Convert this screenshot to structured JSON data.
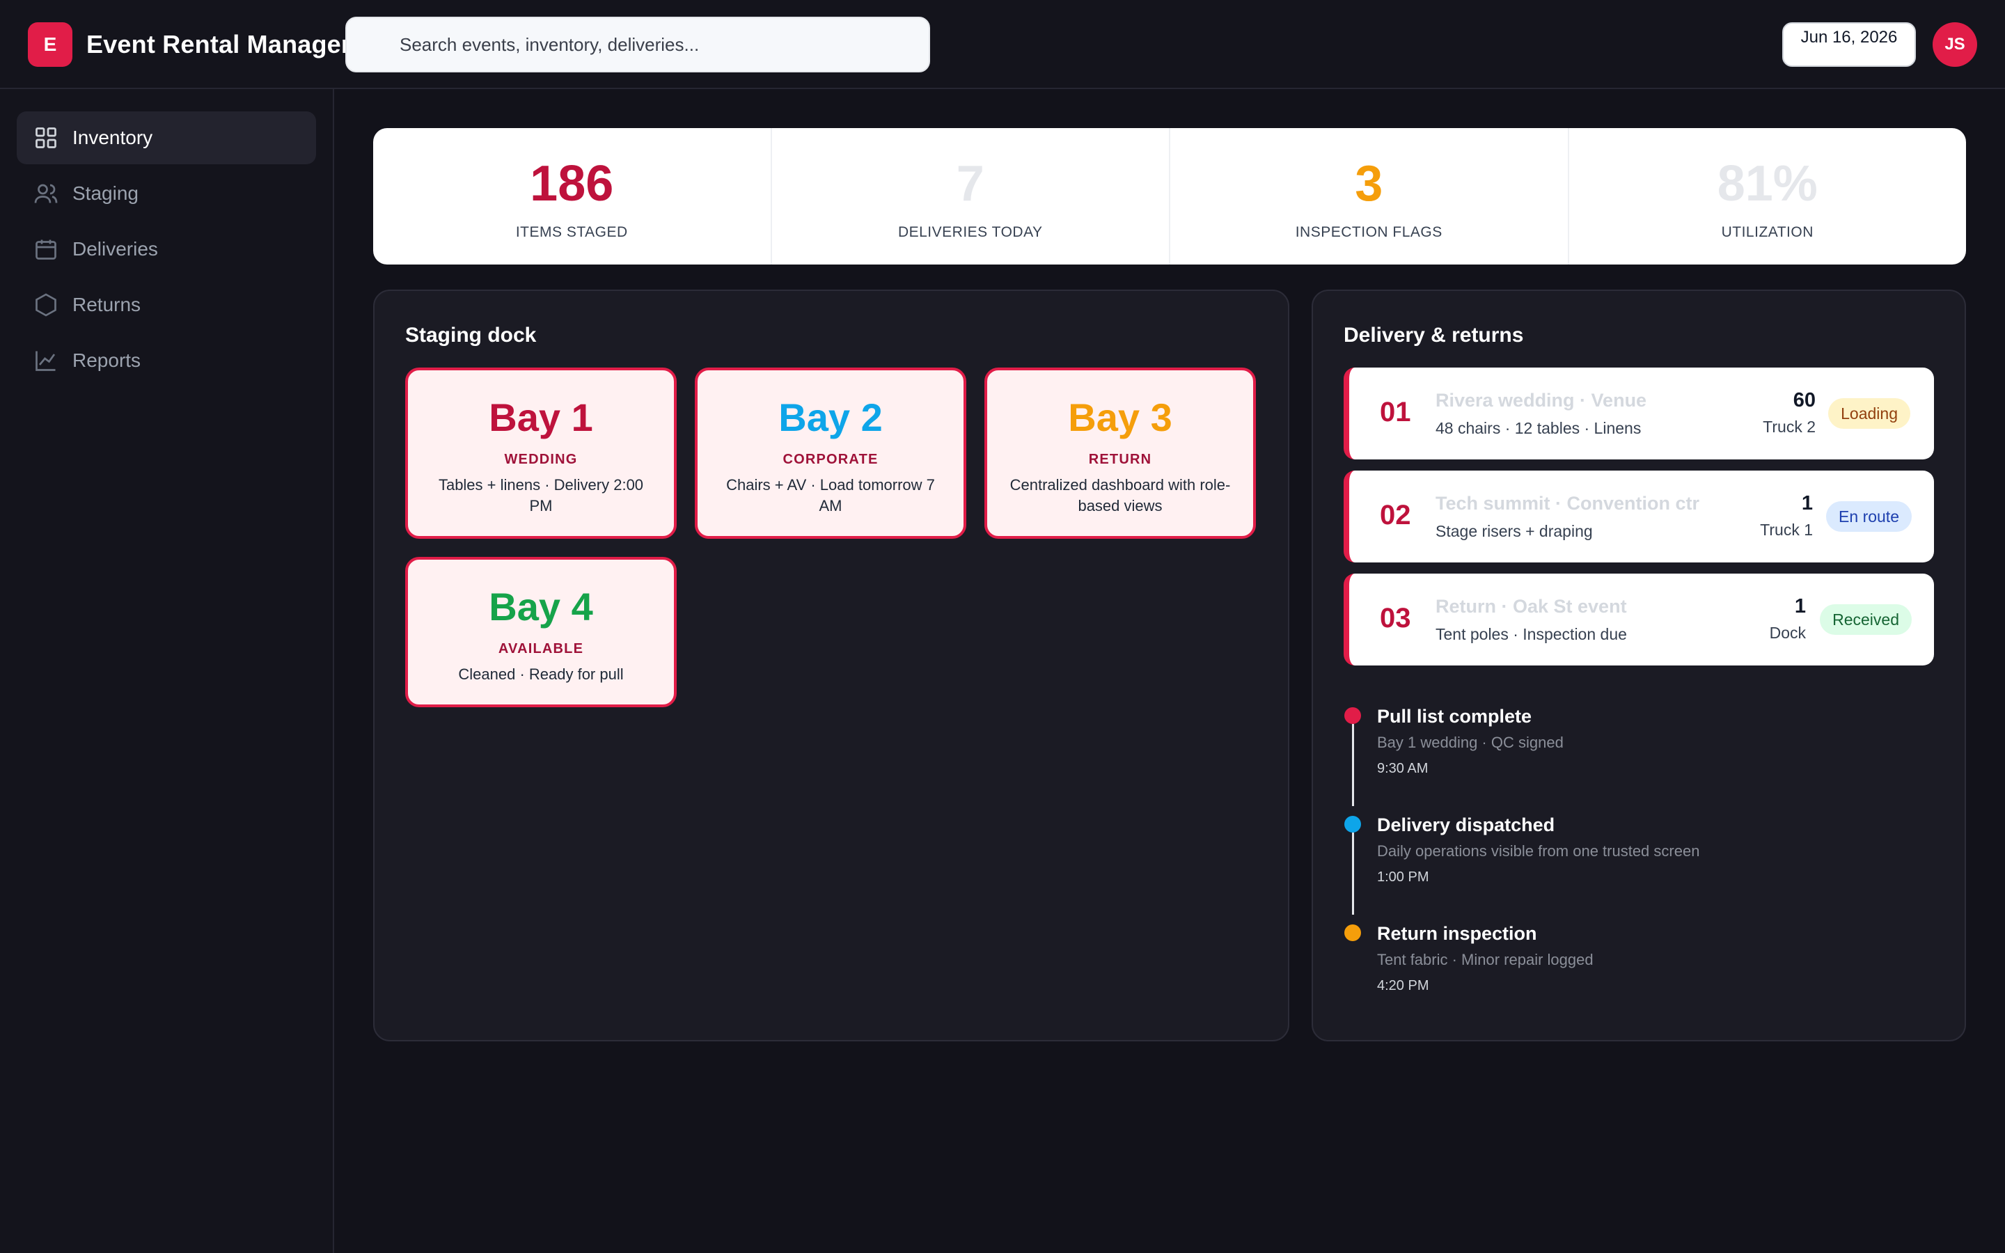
{
  "app": {
    "logo_letter": "E",
    "title": "Event Rental Manager"
  },
  "search": {
    "placeholder": "Search events, inventory, deliveries..."
  },
  "header": {
    "date": "Jun 16, 2026",
    "avatar_initials": "JS"
  },
  "sidebar": {
    "items": [
      {
        "label": "Inventory",
        "icon": "grid-icon",
        "active": true
      },
      {
        "label": "Staging",
        "icon": "users-icon",
        "active": false
      },
      {
        "label": "Deliveries",
        "icon": "calendar-icon",
        "active": false
      },
      {
        "label": "Returns",
        "icon": "hexagon-icon",
        "active": false
      },
      {
        "label": "Reports",
        "icon": "chart-line-icon",
        "active": false
      }
    ]
  },
  "stats": [
    {
      "value": "186",
      "label": "ITEMS STAGED",
      "color": "#be123c"
    },
    {
      "value": "7",
      "label": "DELIVERIES TODAY",
      "color": "#e5e7eb"
    },
    {
      "value": "3",
      "label": "INSPECTION FLAGS",
      "color": "#f59e0b"
    },
    {
      "value": "81%",
      "label": "UTILIZATION",
      "color": "#e5e7eb"
    }
  ],
  "staging": {
    "title": "Staging dock",
    "bays": [
      {
        "name": "Bay 1",
        "type": "WEDDING",
        "desc": "Tables + linens · Delivery 2:00 PM",
        "color": "#be123c"
      },
      {
        "name": "Bay 2",
        "type": "CORPORATE",
        "desc": "Chairs + AV · Load tomorrow 7 AM",
        "color": "#0ea5e9"
      },
      {
        "name": "Bay 3",
        "type": "RETURN",
        "desc": "Centralized dashboard with role-based views",
        "color": "#f59e0b"
      },
      {
        "name": "Bay 4",
        "type": "AVAILABLE",
        "desc": "Cleaned · Ready for pull",
        "color": "#16a34a"
      }
    ]
  },
  "deliveries": {
    "title": "Delivery & returns",
    "items": [
      {
        "num": "01",
        "title": "Rivera wedding · Venue",
        "sub": "48 chairs · 12 tables · Linens",
        "qty": "60",
        "truck": "Truck 2",
        "status": "Loading",
        "status_bg": "#fef3c7",
        "status_fg": "#92400e"
      },
      {
        "num": "02",
        "title": "Tech summit · Convention ctr",
        "sub": "Stage risers + draping",
        "qty": "1",
        "truck": "Truck 1",
        "status": "En route",
        "status_bg": "#dbeafe",
        "status_fg": "#1e40af"
      },
      {
        "num": "03",
        "title": "Return · Oak St event",
        "sub": "Tent poles · Inspection due",
        "qty": "1",
        "truck": "Dock",
        "status": "Received",
        "status_bg": "#dcfce7",
        "status_fg": "#166534"
      }
    ]
  },
  "timeline": [
    {
      "title": "Pull list complete",
      "sub": "Bay 1 wedding · QC signed",
      "time": "9:30 AM",
      "color": "#e11d48"
    },
    {
      "title": "Delivery dispatched",
      "sub": "Daily operations visible from one trusted screen",
      "time": "1:00 PM",
      "color": "#0ea5e9"
    },
    {
      "title": "Return inspection",
      "sub": "Tent fabric · Minor repair logged",
      "time": "4:20 PM",
      "color": "#f59e0b"
    }
  ]
}
